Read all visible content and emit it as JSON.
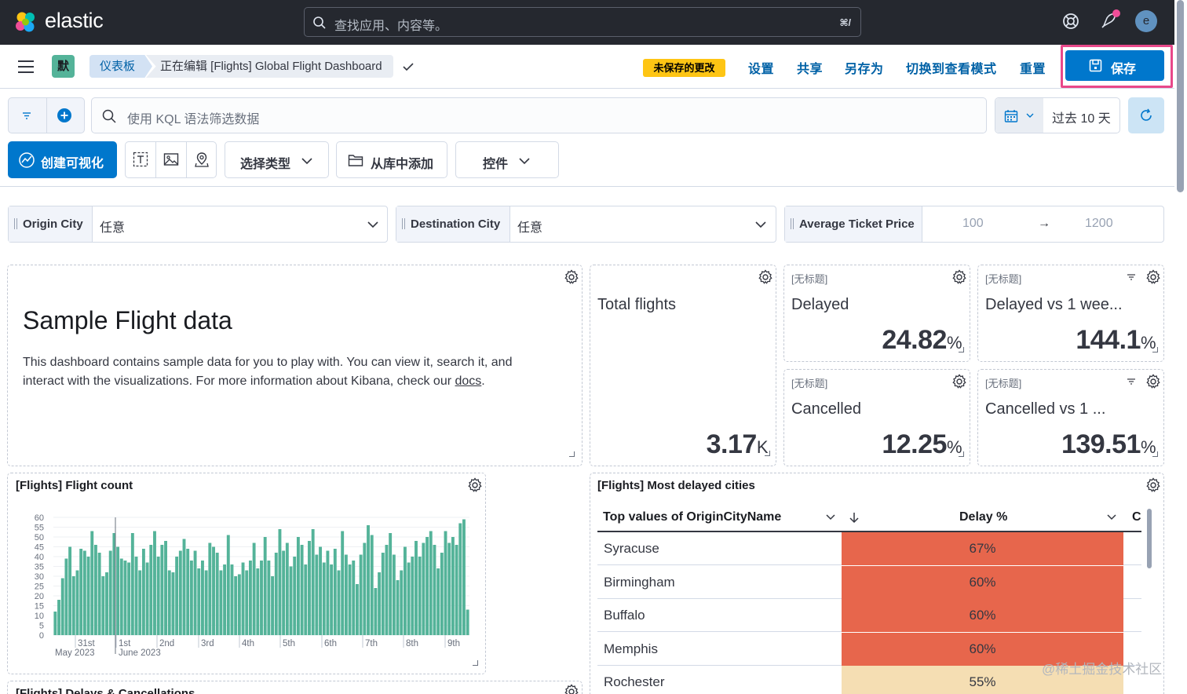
{
  "header": {
    "brand": "elastic",
    "search_placeholder": "查找应用、内容等。",
    "search_shortcut": "⌘/",
    "avatar_initial": "e"
  },
  "nav": {
    "app_badge": "默",
    "breadcrumb_root": "仪表板",
    "breadcrumb_current": "正在编辑 [Flights] Global Flight Dashboard",
    "unsaved_badge": "未保存的更改",
    "links": [
      "设置",
      "共享",
      "另存为",
      "切换到查看模式",
      "重置"
    ],
    "save_label": "保存"
  },
  "query": {
    "placeholder": "使用 KQL 语法筛选数据",
    "time_range": "过去 10 天"
  },
  "toolbar": {
    "create_label": "创建可视化",
    "select_type_label": "选择类型",
    "add_from_library_label": "从库中添加",
    "controls_label": "控件"
  },
  "controls": [
    {
      "label": "Origin City",
      "value": "任意"
    },
    {
      "label": "Destination City",
      "value": "任意"
    },
    {
      "label": "Average Ticket Price",
      "min": "100",
      "max": "1200",
      "arrow": "→"
    }
  ],
  "markdown_panel": {
    "title": "Sample Flight data",
    "body": "This dashboard contains sample data for you to play with. You can view it, search it, and interact with the visualizations. For more information about Kibana, check our ",
    "link": "docs",
    "period": "."
  },
  "metrics": {
    "total": {
      "label": "Total flights",
      "value": "3.17",
      "unit": "K"
    },
    "untitled": "[无标题]",
    "delayed": {
      "label": "Delayed",
      "value": "24.82",
      "unit": "%"
    },
    "delayed_vs": {
      "label": "Delayed vs 1 wee...",
      "value": "144.1",
      "unit": "%"
    },
    "cancelled": {
      "label": "Cancelled",
      "value": "12.25",
      "unit": "%"
    },
    "cancelled_vs": {
      "label": "Cancelled vs 1 ...",
      "value": "139.51",
      "unit": "%"
    }
  },
  "flight_count_panel": {
    "title": "[Flights] Flight count"
  },
  "delays_panel": {
    "title": "[Flights] Delays & Cancellations"
  },
  "delayed_cities": {
    "title": "[Flights] Most delayed cities",
    "col1": "Top values of OriginCityName",
    "col2": "Delay %",
    "col3": "C",
    "rows": [
      {
        "city": "Syracuse",
        "delay": "67%",
        "color": "#e7664c"
      },
      {
        "city": "Birmingham",
        "delay": "60%",
        "color": "#e7664c"
      },
      {
        "city": "Buffalo",
        "delay": "60%",
        "color": "#e7664c"
      },
      {
        "city": "Memphis",
        "delay": "60%",
        "color": "#e7664c"
      },
      {
        "city": "Rochester",
        "delay": "55%",
        "color": "#f5deb3"
      }
    ]
  },
  "watermark": "@稀土掘金技术社区",
  "chart_data": {
    "type": "bar",
    "title": "[Flights] Flight count",
    "ylim": [
      0,
      60
    ],
    "y_ticks": [
      0,
      5,
      10,
      15,
      20,
      25,
      30,
      35,
      40,
      45,
      50,
      55,
      60
    ],
    "x_tick_labels": [
      {
        "label": "31st",
        "sub": "May 2023"
      },
      {
        "label": "1st",
        "sub": "June 2023"
      },
      {
        "label": "2nd",
        "sub": ""
      },
      {
        "label": "3rd",
        "sub": ""
      },
      {
        "label": "4th",
        "sub": ""
      },
      {
        "label": "5th",
        "sub": ""
      },
      {
        "label": "6th",
        "sub": ""
      },
      {
        "label": "7th",
        "sub": ""
      },
      {
        "label": "8th",
        "sub": ""
      },
      {
        "label": "9th",
        "sub": ""
      }
    ],
    "values": [
      12,
      18,
      29,
      39,
      45,
      30,
      33,
      44,
      43,
      40,
      53,
      46,
      42,
      30,
      32,
      43,
      52,
      45,
      39,
      38,
      37,
      52,
      40,
      33,
      44,
      37,
      46,
      53,
      40,
      46,
      48,
      33,
      32,
      40,
      43,
      49,
      44,
      38,
      43,
      34,
      38,
      33,
      47,
      45,
      42,
      33,
      36,
      51,
      36,
      30,
      31,
      37,
      33,
      38,
      47,
      34,
      38,
      50,
      38,
      30,
      42,
      54,
      43,
      47,
      35,
      40,
      50,
      46,
      36,
      48,
      54,
      41,
      45,
      37,
      43,
      36,
      44,
      33,
      53,
      41,
      36,
      38,
      26,
      41,
      47,
      56,
      51,
      24,
      32,
      42,
      46,
      52,
      41,
      28,
      33,
      45,
      37,
      40,
      48,
      40,
      47,
      50,
      53,
      46,
      34,
      42,
      53,
      47,
      50,
      46,
      57,
      59,
      13
    ],
    "bar_color": "#54b399",
    "grid": true
  }
}
